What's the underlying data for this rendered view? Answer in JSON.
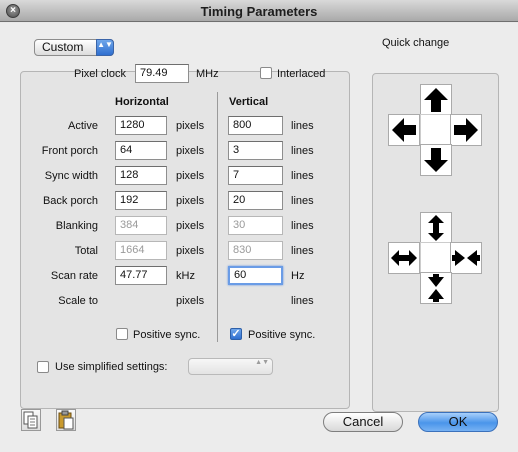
{
  "window": {
    "title": "Timing Parameters",
    "close_glyph": "×"
  },
  "preset": {
    "value": "Custom",
    "arrows": "▲▼"
  },
  "pixel_clock": {
    "label": "Pixel clock",
    "value": "79.49",
    "unit": "MHz"
  },
  "interlaced": {
    "label": "Interlaced",
    "checked": false
  },
  "columns": {
    "horizontal": "Horizontal",
    "vertical": "Vertical"
  },
  "rows": [
    {
      "label": "Active",
      "h_value": "1280",
      "h_unit": "pixels",
      "v_value": "800",
      "v_unit": "lines"
    },
    {
      "label": "Front porch",
      "h_value": "64",
      "h_unit": "pixels",
      "v_value": "3",
      "v_unit": "lines"
    },
    {
      "label": "Sync width",
      "h_value": "128",
      "h_unit": "pixels",
      "v_value": "7",
      "v_unit": "lines"
    },
    {
      "label": "Back porch",
      "h_value": "192",
      "h_unit": "pixels",
      "v_value": "20",
      "v_unit": "lines"
    },
    {
      "label": "Blanking",
      "h_value": "384",
      "h_unit": "pixels",
      "v_value": "30",
      "v_unit": "lines"
    },
    {
      "label": "Total",
      "h_value": "1664",
      "h_unit": "pixels",
      "v_value": "830",
      "v_unit": "lines"
    },
    {
      "label": "Scan rate",
      "h_value": "47.77",
      "h_unit": "kHz",
      "v_value": "60",
      "v_unit": "Hz"
    },
    {
      "label": "Scale to",
      "h_value": "",
      "h_unit": "pixels",
      "v_value": "",
      "v_unit": "lines"
    }
  ],
  "h_sync": {
    "label": "Positive sync.",
    "checked": false
  },
  "v_sync": {
    "label": "Positive sync.",
    "checked": true,
    "check_glyph": "✓"
  },
  "simplified": {
    "label": "Use simplified settings:",
    "checked": false,
    "arrows": "▲▼"
  },
  "quick_change": {
    "label": "Quick change"
  },
  "buttons": {
    "cancel": "Cancel",
    "ok": "OK"
  },
  "icons": {
    "copy": "copy-icon",
    "paste": "paste-icon",
    "shift": [
      "arrow-up-icon",
      "arrow-left-icon",
      "arrow-right-icon",
      "arrow-down-icon"
    ],
    "resize": [
      "expand-vertical-icon",
      "expand-horizontal-icon",
      "shrink-horizontal-icon",
      "shrink-vertical-icon"
    ]
  },
  "colors": {
    "accent": "#3b7ee0",
    "default_button": "#4a95ea"
  }
}
